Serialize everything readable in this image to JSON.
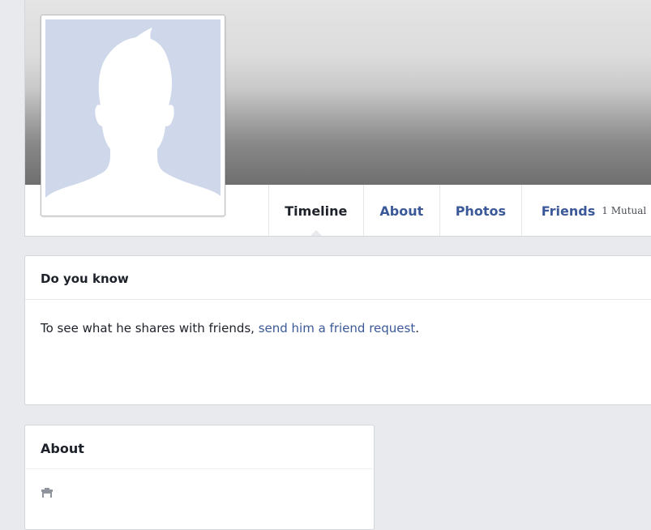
{
  "profile": {
    "picture_alt": "",
    "tabs": [
      {
        "label": "Timeline",
        "active": true
      },
      {
        "label": "About"
      },
      {
        "label": "Photos"
      },
      {
        "label": "Friends",
        "badge": "1 Mutual"
      }
    ]
  },
  "do_you_know": {
    "title": "Do you know",
    "text": "To see what he shares with friends, ",
    "link": "send him a friend request",
    "text_end": "."
  },
  "about": {
    "title": "About",
    "icon": "work-icon"
  },
  "colors": {
    "link": "#3b5998",
    "background": "#e9eaed",
    "silhouette_bg": "#cfd8ea"
  }
}
